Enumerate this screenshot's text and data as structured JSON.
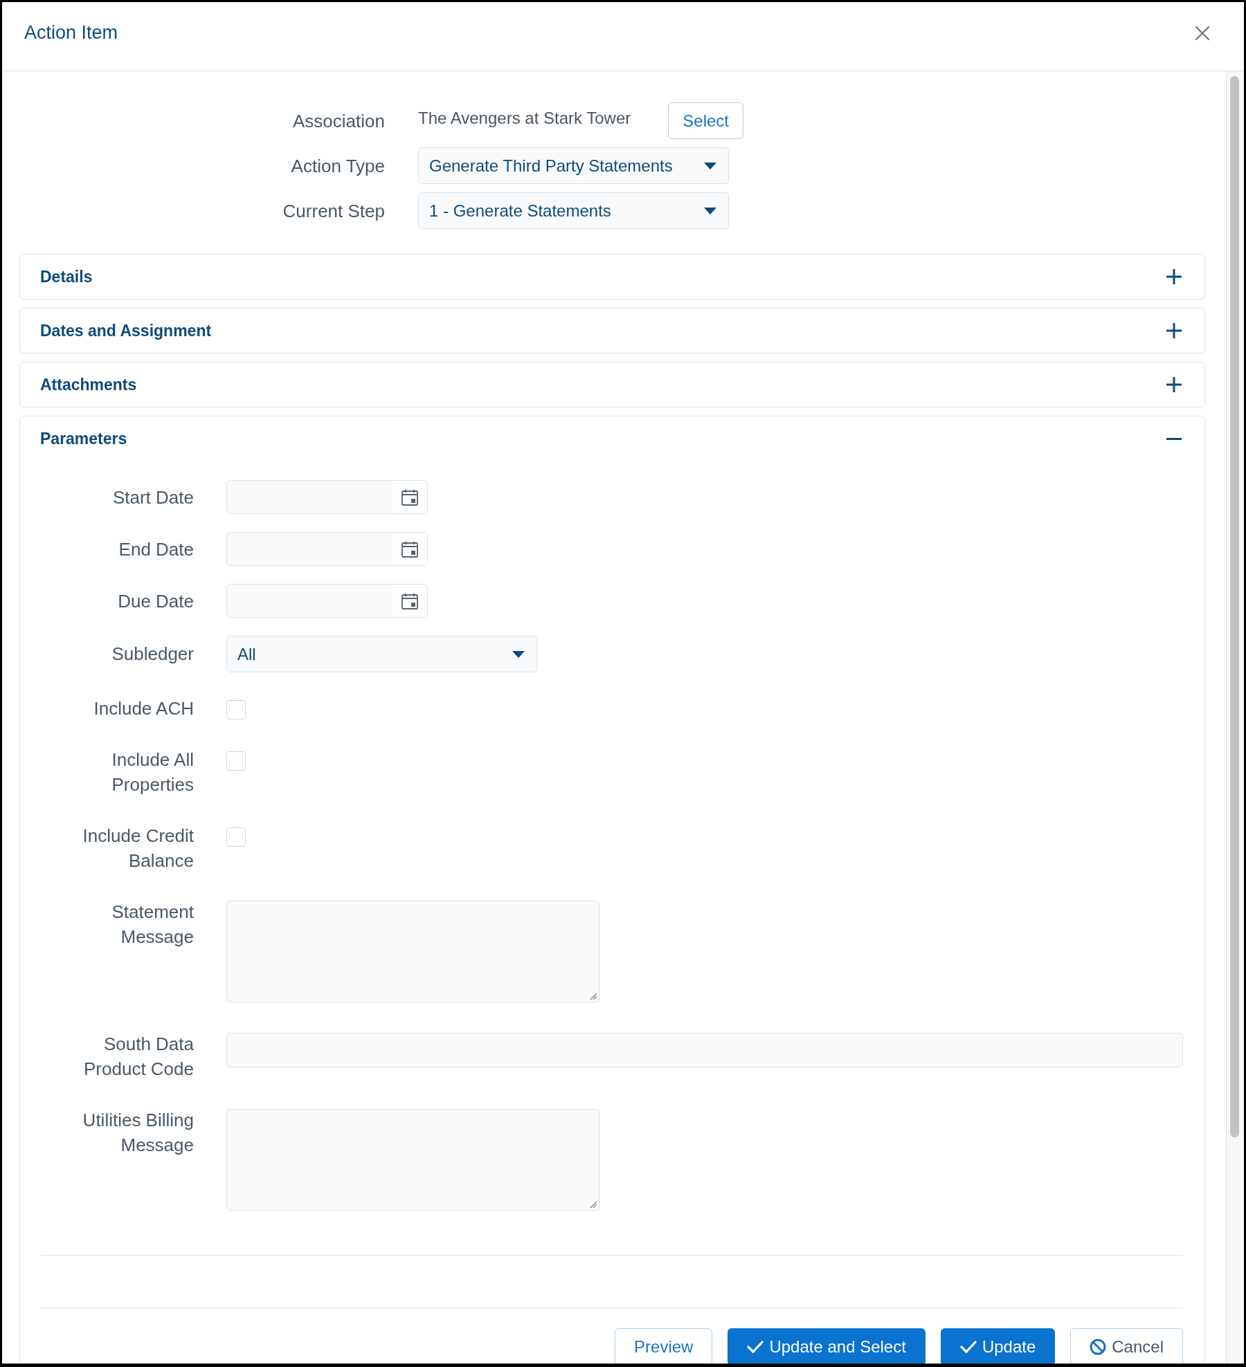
{
  "dialog": {
    "title": "Action Item"
  },
  "header_fields": [
    {
      "kind": "text",
      "label": "Association",
      "value": "The Avengers at Stark Tower",
      "button": "Select"
    },
    {
      "kind": "select",
      "label": "Action Type",
      "value": "Generate Third Party Statements"
    },
    {
      "kind": "select",
      "label": "Current Step",
      "value": "1 - Generate Statements"
    }
  ],
  "sections": [
    {
      "title": "Details",
      "expanded": false
    },
    {
      "title": "Dates and Assignment",
      "expanded": false
    },
    {
      "title": "Attachments",
      "expanded": false
    },
    {
      "title": "Parameters",
      "expanded": true,
      "fields": [
        {
          "kind": "date",
          "label": "Start Date"
        },
        {
          "kind": "date",
          "label": "End Date"
        },
        {
          "kind": "date",
          "label": "Due Date"
        },
        {
          "kind": "select",
          "label": "Subledger",
          "value": "All"
        },
        {
          "kind": "checkbox",
          "label": "Include ACH",
          "checked": false
        },
        {
          "kind": "checkbox",
          "label": "Include All Properties",
          "checked": false
        },
        {
          "kind": "checkbox",
          "label": "Include Credit Balance",
          "checked": false
        },
        {
          "kind": "textarea",
          "label": "Statement Message"
        },
        {
          "kind": "input",
          "label": "South Data Product Code"
        },
        {
          "kind": "textarea",
          "label": "Utilities Billing Message"
        }
      ],
      "buttons": [
        {
          "kind": "secondary",
          "label": "Preview"
        },
        {
          "kind": "primary",
          "label": "Update and Select"
        },
        {
          "kind": "primary",
          "label": "Update"
        },
        {
          "kind": "cancel",
          "label": "Cancel"
        }
      ]
    }
  ]
}
